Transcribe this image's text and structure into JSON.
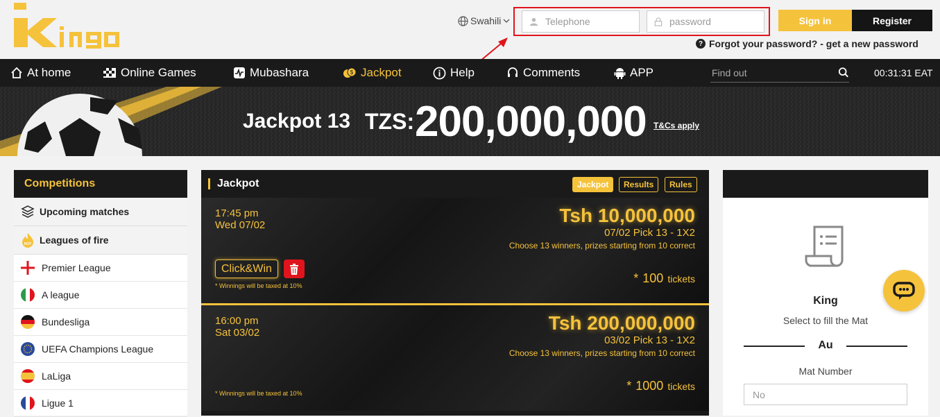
{
  "brand": {
    "logo_text": "KING",
    "accent": "#f5c23b",
    "dark": "#1a1a1a",
    "alert": "#e0141c"
  },
  "header": {
    "language": "Swahili",
    "telephone_placeholder": "Telephone",
    "password_placeholder": "password",
    "signin_label": "Sign in",
    "register_label": "Register",
    "forgot_text": "Forgot your password? - get a new password"
  },
  "nav": {
    "items": [
      {
        "label": "At home",
        "icon": "home-icon"
      },
      {
        "label": "Online Games",
        "icon": "checkered-flag-icon"
      },
      {
        "label": "Mubashara",
        "icon": "live-pulse-icon"
      },
      {
        "label": "Jackpot",
        "icon": "coins-icon"
      },
      {
        "label": "Help",
        "icon": "info-icon"
      },
      {
        "label": "Comments",
        "icon": "headset-icon"
      },
      {
        "label": "APP",
        "icon": "android-icon"
      }
    ],
    "search_placeholder": "Find out",
    "clock": "00:31:31 EAT"
  },
  "banner": {
    "title": "Jackpot 13",
    "currency": "TZS:",
    "amount": "200,000,000",
    "tc": "T&Cs apply"
  },
  "sidebar": {
    "title": "Competitions",
    "categories": [
      {
        "label": "Upcoming matches",
        "icon": "layers-icon"
      },
      {
        "label": "Leagues of fire",
        "icon": "flame-icon"
      }
    ],
    "leagues": [
      {
        "label": "Premier League",
        "flag": "england-flag-icon"
      },
      {
        "label": "A league",
        "flag": "italy-flag-icon"
      },
      {
        "label": "Bundesliga",
        "flag": "germany-flag-icon"
      },
      {
        "label": "UEFA Champions League",
        "flag": "eu-flag-icon"
      },
      {
        "label": "LaLiga",
        "flag": "spain-flag-icon"
      },
      {
        "label": "Ligue 1",
        "flag": "france-flag-icon"
      }
    ]
  },
  "center": {
    "title": "Jackpot",
    "tabs": [
      "Jackpot",
      "Results",
      "Rules"
    ],
    "cards": [
      {
        "time": "17:45 pm",
        "date": "Wed 07/02",
        "prize": "Tsh 10,000,000",
        "pick": "07/02 Pick 13 - 1X2",
        "choose": "Choose 13 winners, prizes starting from 10 correct",
        "tickets": "100",
        "tickets_label": "tickets",
        "tax": "* Winnings will be taxed at 10%",
        "clickwin": "Click&Win"
      },
      {
        "time": "16:00 pm",
        "date": "Sat 03/02",
        "prize": "Tsh 200,000,000",
        "pick": "03/02 Pick 13 - 1X2",
        "choose": "Choose 13 winners, prizes starting from 10 correct",
        "tickets": "1000",
        "tickets_label": "tickets",
        "tax": "* Winnings will be taxed at 10%"
      }
    ]
  },
  "right_panel": {
    "name": "King",
    "subtitle": "Select to fill the Mat",
    "divider_label": "Au",
    "mat_label": "Mat Number",
    "mat_placeholder": "No"
  }
}
